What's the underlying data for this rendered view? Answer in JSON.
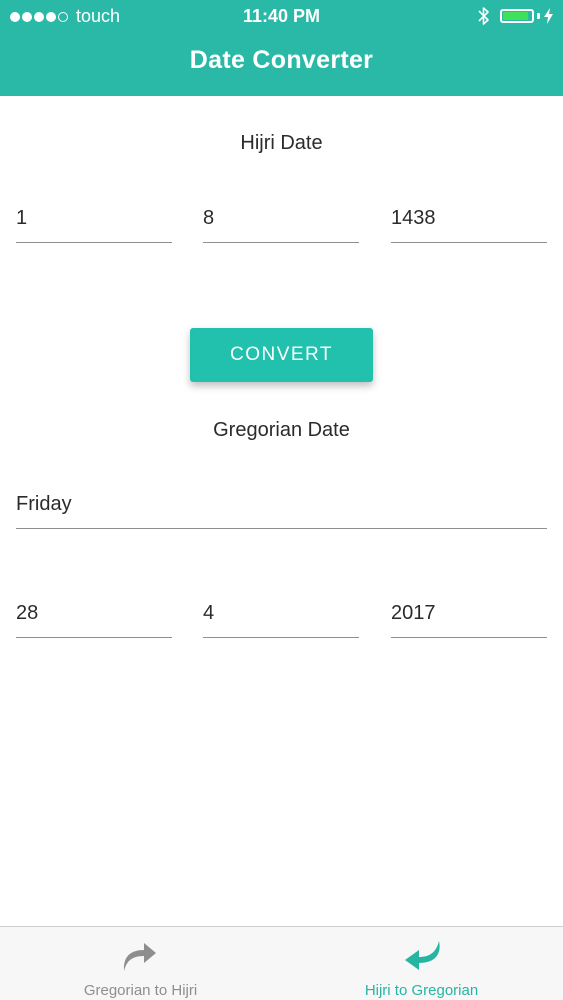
{
  "status_bar": {
    "carrier": "touch",
    "time": "11:40 PM",
    "battery_level": 0.9
  },
  "header": {
    "title": "Date Converter"
  },
  "hijri": {
    "label": "Hijri Date",
    "day": "1",
    "month": "8",
    "year": "1438"
  },
  "convert_label": "CONVERT",
  "gregorian": {
    "label": "Gregorian Date",
    "weekday": "Friday",
    "day": "28",
    "month": "4",
    "year": "2017"
  },
  "tabs": [
    {
      "label": "Gregorian to Hijri",
      "icon": "redo-arrow-icon",
      "active": false
    },
    {
      "label": "Hijri to Gregorian",
      "icon": "undo-arrow-icon",
      "active": true
    }
  ],
  "colors": {
    "primary": "#2bb9a7",
    "button": "#22c1ad",
    "tab_active": "#26b5a3",
    "tab_inactive": "#8e8e8e"
  }
}
